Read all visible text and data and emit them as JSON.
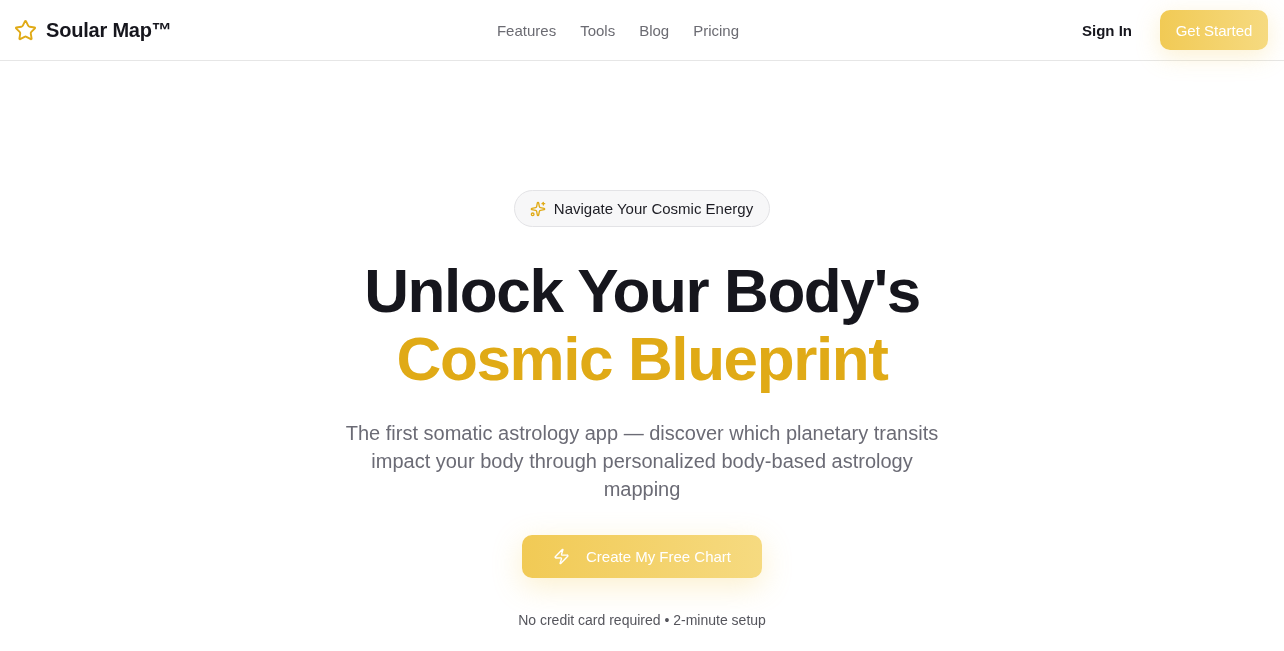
{
  "header": {
    "logo": "Soular Map™",
    "nav": [
      "Features",
      "Tools",
      "Blog",
      "Pricing"
    ],
    "sign_in": "Sign In",
    "cta": "Get Started"
  },
  "hero": {
    "badge": "Navigate Your Cosmic Energy",
    "headline": "Unlock Your Body's",
    "headline_accent": "Cosmic Blueprint",
    "subtitle": "The first somatic astrology app — discover which planetary transits impact your body through personalized body-based astrology mapping",
    "cta": "Create My Free Chart",
    "note": "No credit card required • 2-minute setup"
  }
}
